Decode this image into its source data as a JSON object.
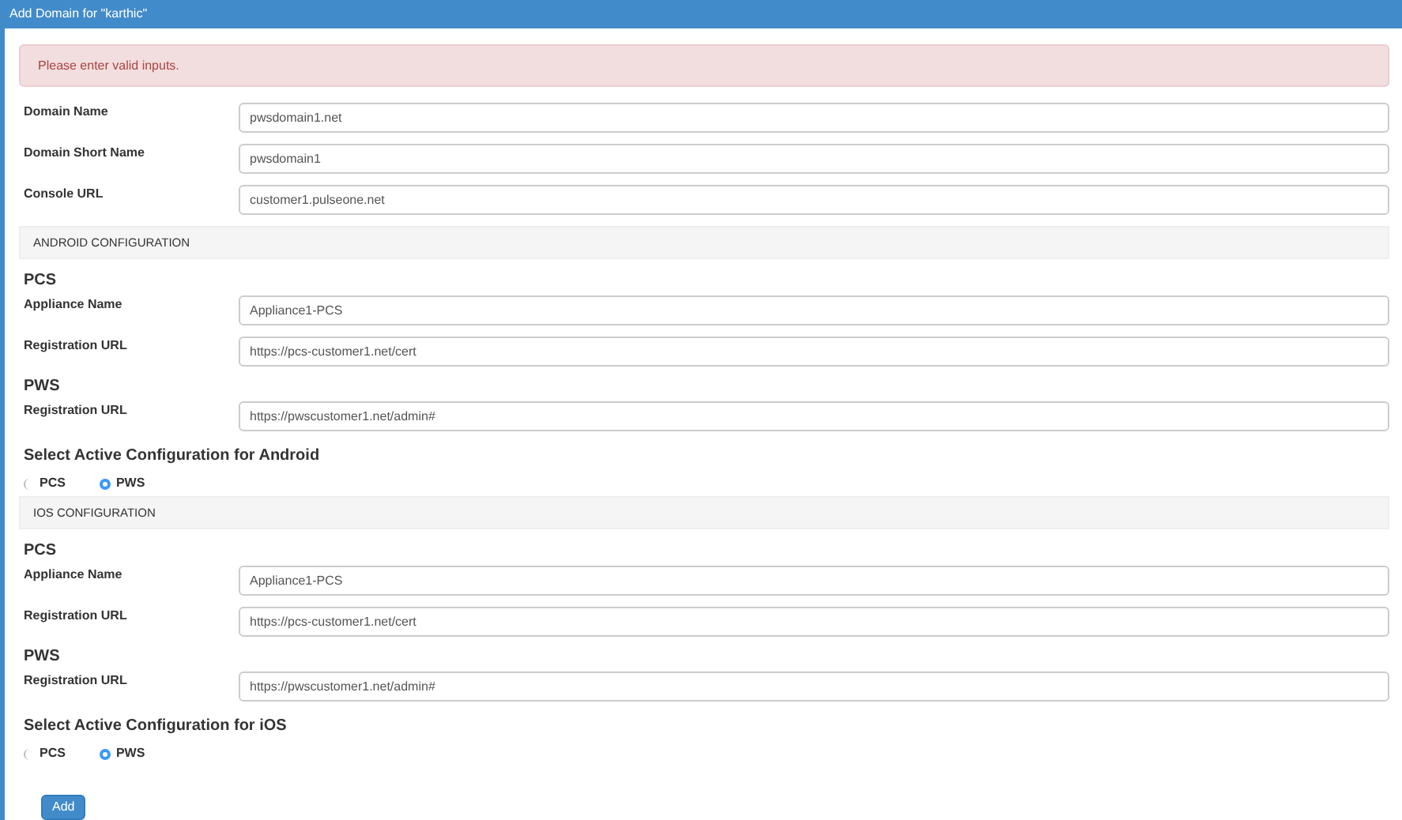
{
  "header": {
    "title": "Add Domain for \"karthic\""
  },
  "alert": {
    "text": "Please enter valid inputs."
  },
  "fields": [
    {
      "label": "Domain Name",
      "value": "pwsdomain1.net"
    },
    {
      "label": "Domain Short Name",
      "value": "pwsdomain1"
    },
    {
      "label": "Console URL",
      "value": "customer1.pulseone.net"
    }
  ],
  "sections": [
    {
      "title": "ANDROID CONFIGURATION",
      "groups": [
        {
          "title": "PCS",
          "fields": [
            {
              "label": "Appliance Name",
              "value": "Appliance1-PCS"
            },
            {
              "label": "Registration URL",
              "value": "https://pcs-customer1.net/cert"
            }
          ]
        },
        {
          "title": "PWS",
          "fields": [
            {
              "label": "Registration URL",
              "value": "https://pwscustomer1.net/admin#"
            }
          ]
        }
      ],
      "select_title": "Select Active Configuration for Android",
      "options": [
        {
          "label": "PCS",
          "selected": false
        },
        {
          "label": "PWS",
          "selected": true
        }
      ]
    },
    {
      "title": "IOS CONFIGURATION",
      "groups": [
        {
          "title": "PCS",
          "fields": [
            {
              "label": "Appliance Name",
              "value": "Appliance1-PCS"
            },
            {
              "label": "Registration URL",
              "value": "https://pcs-customer1.net/cert"
            }
          ]
        },
        {
          "title": "PWS",
          "fields": [
            {
              "label": "Registration URL",
              "value": "https://pwscustomer1.net/admin#"
            }
          ]
        }
      ],
      "select_title": "Select Active Configuration for iOS",
      "options": [
        {
          "label": "PCS",
          "selected": false
        },
        {
          "label": "PWS",
          "selected": true
        }
      ]
    }
  ],
  "submit": {
    "label": "Add"
  }
}
